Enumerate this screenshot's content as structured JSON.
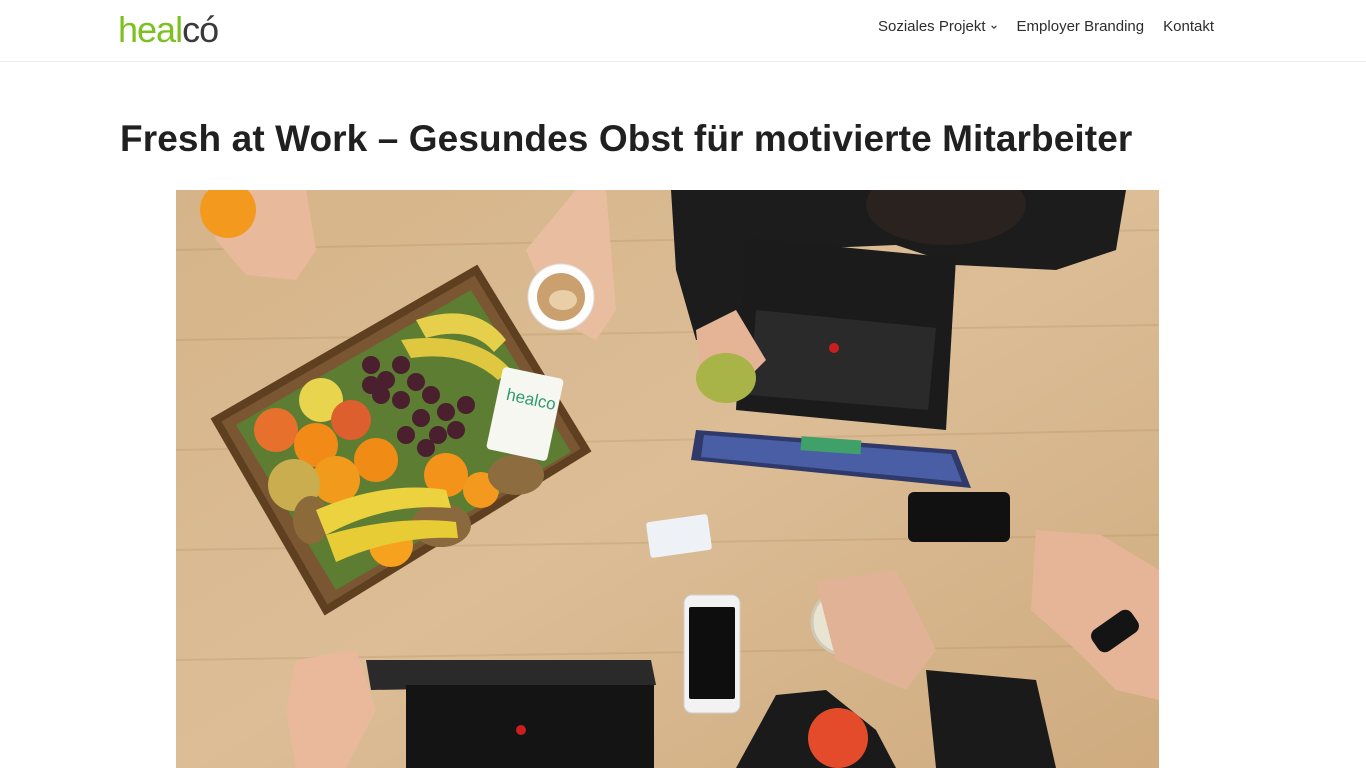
{
  "site": {
    "logo_part1": "heal",
    "logo_part2": "có"
  },
  "nav": {
    "items": [
      {
        "label": "Soziales Projekt",
        "has_dropdown": true,
        "icon": "chevron-down-icon"
      },
      {
        "label": "Employer Branding",
        "has_dropdown": false
      },
      {
        "label": "Kontakt",
        "has_dropdown": false
      }
    ]
  },
  "article": {
    "title": "Fresh at Work – Gesundes Obst für motivierte Mitarbeiter",
    "image_tag_text": "healco"
  },
  "colors": {
    "brand_green": "#7cc11f",
    "logo_dark": "#3a3a3a",
    "title": "#202020",
    "wood": "#d9b98f"
  }
}
